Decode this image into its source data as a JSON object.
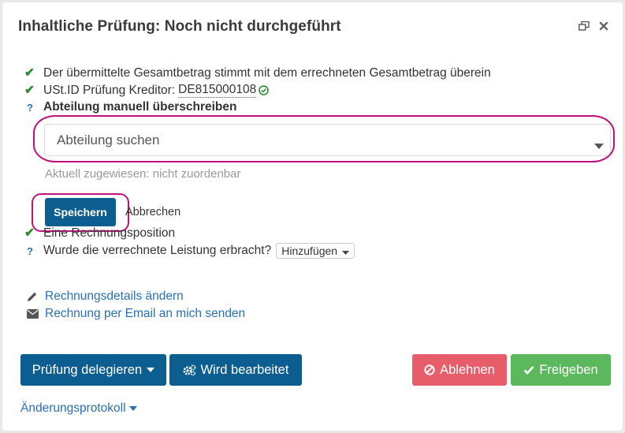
{
  "panel": {
    "title": "Inhaltliche Prüfung: Noch nicht durchgeführt"
  },
  "checks": {
    "total_match": "Der übermittelte Gesamtbetrag stimmt mit dem errechneten Gesamtbetrag überein",
    "vat_label": "USt.ID Prüfung Kreditor:",
    "vat_id": "DE815000108",
    "department_override": "Abteilung manuell überschreiben",
    "invoice_position": "Eine Rechnungsposition",
    "service_question": "Wurde die verrechnete Leistung erbracht?",
    "add_select": "Hinzufügen"
  },
  "department": {
    "placeholder": "Abteilung suchen",
    "current": "Aktuell zugewiesen: nicht zuordenbar",
    "save": "Speichern",
    "cancel": "Abbrechen"
  },
  "links": {
    "edit_details": "Rechnungsdetails ändern",
    "email_me": "Rechnung per Email an mich senden"
  },
  "actions": {
    "delegate": "Prüfung delegieren",
    "in_progress": "Wird bearbeitet",
    "reject": "Ablehnen",
    "approve": "Freigeben"
  },
  "changelog": "Änderungsprotokoll",
  "colors": {
    "primary": "#0c5e91",
    "danger": "#e85d6a",
    "success": "#5cb85c",
    "link": "#2a6fb5",
    "highlight": "#c0107a"
  },
  "icons": [
    "restore-window-icon",
    "close-icon",
    "check-icon",
    "question-icon",
    "check-circle-icon",
    "caret-down-icon",
    "pencil-icon",
    "envelope-icon",
    "cogs-icon",
    "ban-icon"
  ]
}
